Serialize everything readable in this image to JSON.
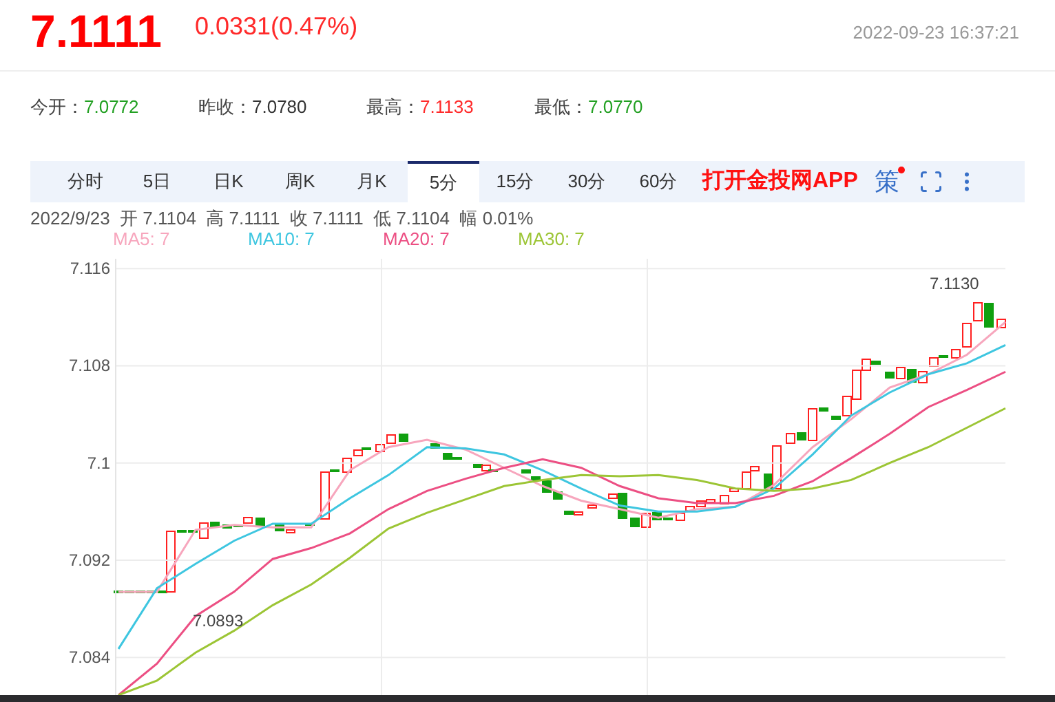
{
  "quote": {
    "price": "7.1111",
    "change": "0.0331(0.47%)",
    "timestamp": "2022-09-23 16:37:21"
  },
  "stats": [
    {
      "label": "今开：",
      "value": "7.0772",
      "color": "#22a022"
    },
    {
      "label": "昨收：",
      "value": "7.0780",
      "color": "#333333"
    },
    {
      "label": "最高：",
      "value": "7.1133",
      "color": "#ff2a2a"
    },
    {
      "label": "最低：",
      "value": "7.0770",
      "color": "#22a022"
    }
  ],
  "tabs": [
    {
      "label": "分时",
      "selected": false
    },
    {
      "label": "5日",
      "selected": false
    },
    {
      "label": "日K",
      "selected": false
    },
    {
      "label": "周K",
      "selected": false
    },
    {
      "label": "月K",
      "selected": false
    },
    {
      "label": "5分",
      "selected": true
    },
    {
      "label": "15分",
      "selected": false
    },
    {
      "label": "30分",
      "selected": false
    },
    {
      "label": "60分",
      "selected": false
    }
  ],
  "app_link": "打开金投网APP",
  "strategy_label": "策",
  "bar_info": "2022/9/23  开 7.1104  高 7.1111  收 7.1111  低 7.1104  幅 0.01%",
  "ma_legend": [
    "MA5: 7",
    "MA10: 7",
    "MA20: 7",
    "MA30: 7"
  ],
  "chart": {
    "chart_data": {
      "type": "line",
      "grid": true,
      "ylim": [
        7.0809,
        7.1168
      ],
      "yticks": [
        7.084,
        7.092,
        {
          "value": 7.1,
          "label": "7.1"
        },
        7.108,
        7.116
      ],
      "series": [
        {
          "color": "#f7a6bd",
          "values": [
            7.0894,
            7.0894,
            7.0945,
            7.0949,
            7.0947,
            7.0947,
            7.0994,
            7.1013,
            7.1019,
            7.1011,
            7.0996,
            7.0981,
            7.0969,
            7.0962,
            7.0955,
            7.0962,
            7.0964,
            7.0982,
            7.1013,
            7.1036,
            7.1062,
            7.1073,
            7.1089,
            7.1116
          ]
        },
        {
          "color": "#3ec6e0",
          "values": [
            7.0847,
            7.0897,
            7.0917,
            7.0936,
            7.095,
            7.095,
            7.0971,
            7.099,
            7.1013,
            7.1012,
            7.1007,
            7.0994,
            7.0979,
            7.0965,
            7.096,
            7.096,
            7.0964,
            7.0979,
            7.1007,
            7.1039,
            7.1058,
            7.1073,
            7.1082,
            7.1097
          ]
        },
        {
          "color": "#ec4f83",
          "values": [
            7.0809,
            7.0835,
            7.0874,
            7.0894,
            7.0921,
            7.093,
            7.0942,
            7.0962,
            7.0977,
            7.0987,
            7.0996,
            7.1003,
            7.0996,
            7.0981,
            7.0971,
            7.0967,
            7.0967,
            7.0973,
            7.0985,
            7.1004,
            7.1024,
            7.1046,
            7.106,
            7.1075
          ]
        },
        {
          "color": "#9cc535",
          "values": [
            7.0809,
            7.0821,
            7.0844,
            7.0862,
            7.0883,
            7.09,
            7.0922,
            7.0946,
            7.0959,
            7.097,
            7.0981,
            7.0986,
            7.099,
            7.0989,
            7.099,
            7.0986,
            7.0979,
            7.0977,
            7.0979,
            7.0986,
            7.1,
            7.1013,
            7.1029,
            7.1045
          ]
        }
      ],
      "annotations": [
        {
          "text": "7.0893"
        },
        {
          "text": "7.1130"
        }
      ]
    }
  }
}
